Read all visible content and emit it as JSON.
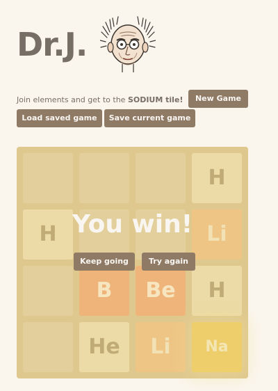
{
  "header": {
    "title": "Dr.J.",
    "portrait_icon": "doctor-portrait-icon"
  },
  "intro": {
    "text_before": "Join elements and get to the",
    "highlight": "SODIUM tile!"
  },
  "buttons": {
    "new_game": "New Game",
    "load_saved": "Load saved game",
    "save_current": "Save current game"
  },
  "board": {
    "rows": [
      [
        "",
        "",
        "",
        "H"
      ],
      [
        "H",
        "",
        "",
        "Li"
      ],
      [
        "",
        "B",
        "Be",
        "H"
      ],
      [
        "",
        "He",
        "Li",
        "Na"
      ]
    ]
  },
  "overlay": {
    "message": "You win!",
    "keep_going": "Keep going",
    "try_again": "Try again"
  },
  "colors": {
    "background": "#faf6ee",
    "board": "#d6b865",
    "button": "#8f7a66"
  }
}
